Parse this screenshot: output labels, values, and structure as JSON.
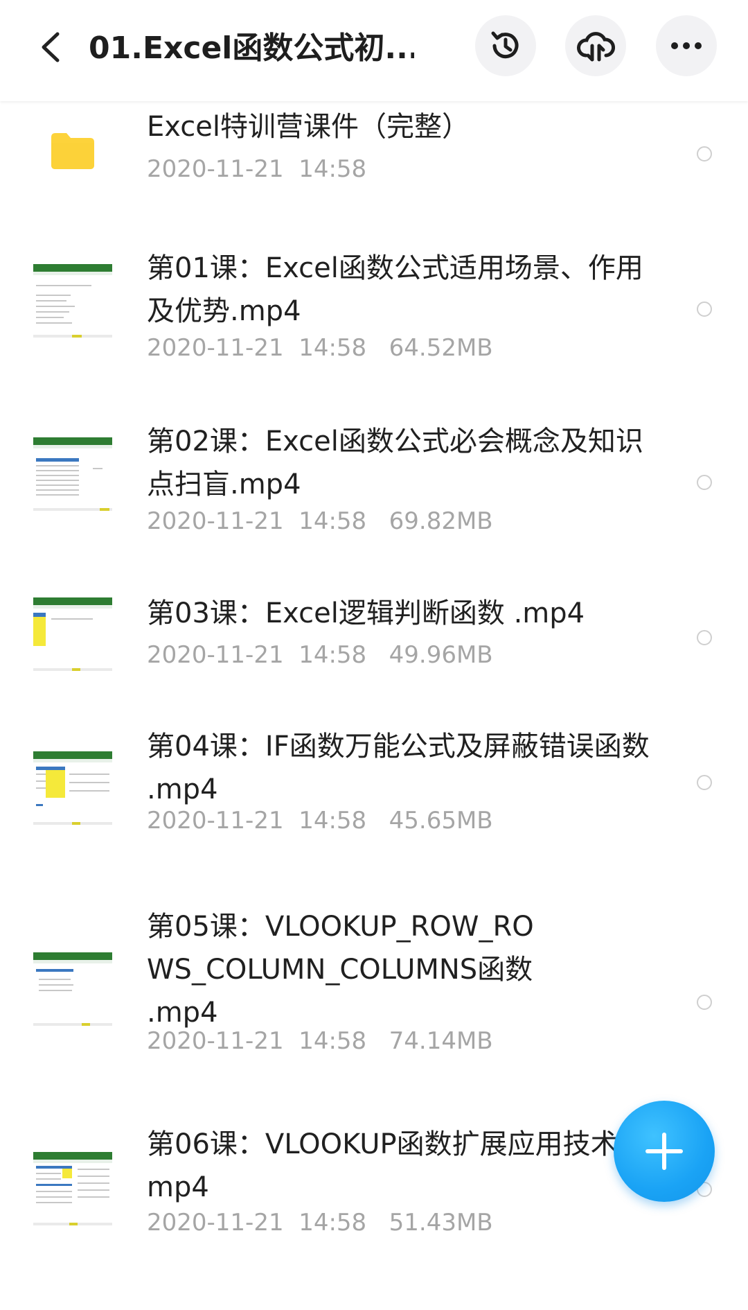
{
  "header": {
    "title": "01.Excel函数公式初...",
    "icons": {
      "back": "back-arrow-icon",
      "history": "history-icon",
      "cloud": "cloud-download-icon",
      "more": "more-icon"
    }
  },
  "colors": {
    "accent": "#1aa3f5",
    "folder": "#fdd33b",
    "meta_text": "#a5a5a5",
    "excel_green": "#2e7d32"
  },
  "files": [
    {
      "type": "folder",
      "name": "Excel特训营课件（完整）",
      "date": "2020-11-21  14:58",
      "size": ""
    },
    {
      "type": "video",
      "name": "第01课：Excel函数公式适用场景、作用及优势.mp4",
      "date": "2020-11-21  14:58",
      "size": "64.52MB"
    },
    {
      "type": "video",
      "name": "第02课：Excel函数公式必会概念及知识点扫盲.mp4",
      "date": "2020-11-21  14:58",
      "size": "69.82MB"
    },
    {
      "type": "video",
      "name": "第03课：Excel逻辑判断函数 .mp4",
      "date": "2020-11-21  14:58",
      "size": "49.96MB"
    },
    {
      "type": "video",
      "name": "第04课：IF函数万能公式及屏蔽错误函数 .mp4",
      "date": "2020-11-21  14:58",
      "size": "45.65MB"
    },
    {
      "type": "video",
      "name": "第05课：VLOOKUP_ROW_ROWS_COLUMN_COLUMNS函数 .mp4",
      "date": "2020-11-21  14:58",
      "size": "74.14MB"
    },
    {
      "type": "video",
      "name": "第06课：VLOOKUP函数扩展应用技术.mp4",
      "date": "2020-11-21  14:58",
      "size": "51.43MB"
    }
  ],
  "fab": {
    "icon": "plus-icon"
  }
}
